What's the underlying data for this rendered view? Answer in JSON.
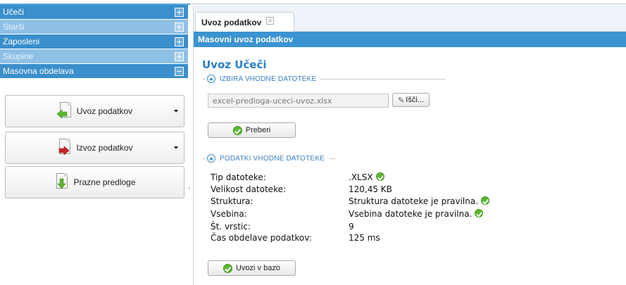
{
  "sidebar": {
    "accordion": [
      {
        "label": "Učeči",
        "state": "plus",
        "active": true
      },
      {
        "label": "Starši",
        "state": "plus",
        "active": false
      },
      {
        "label": "Zaposleni",
        "state": "plus",
        "active": true
      },
      {
        "label": "Skupine",
        "state": "plus",
        "active": false
      },
      {
        "label": "Masovna obdelava",
        "state": "minus",
        "active": true
      }
    ],
    "buttons": [
      {
        "label": "Uvoz podatkov",
        "icon": "import-document-icon"
      },
      {
        "label": "Izvoz podatkov",
        "icon": "export-document-icon"
      },
      {
        "label": "Prazne predloge",
        "icon": "blank-template-icon"
      }
    ]
  },
  "tabs": [
    {
      "label": "Uvoz podatkov"
    }
  ],
  "header": {
    "title": "Masovni uvoz podatkov"
  },
  "page": {
    "title": "Uvoz Učeči"
  },
  "section1": {
    "title": "IZBIRA VHODNE DATOTEKE",
    "file_value": "excel-predloga-uceci-uvoz.xlsx",
    "browse_label": "Išči...",
    "read_label": "Preberi"
  },
  "section2": {
    "title": "PODATKI VHODNE DATOTEKE",
    "rows": [
      {
        "label": "Tip datoteke:",
        "value": ".XLSX",
        "ok": true
      },
      {
        "label": "Velikost datoteke:",
        "value": "120,45 KB",
        "ok": false
      },
      {
        "label": "Struktura:",
        "value": "Struktura datoteke je pravilna.",
        "ok": true
      },
      {
        "label": "Vsebina:",
        "value": "Vsebina datoteke je pravilna.",
        "ok": true
      },
      {
        "label": "Št. vrstic:",
        "value": "9",
        "ok": false
      },
      {
        "label": "Čas obdelave podatkov:",
        "value": "125 ms",
        "ok": false
      }
    ],
    "import_label": "Uvozi v bazo"
  },
  "colors": {
    "accent": "#3b93d0",
    "accordion_active": "#3a8fcc",
    "accordion_inactive": "#8ec0e6",
    "title": "#2c7fc1",
    "ok_green": "#5cb533"
  }
}
